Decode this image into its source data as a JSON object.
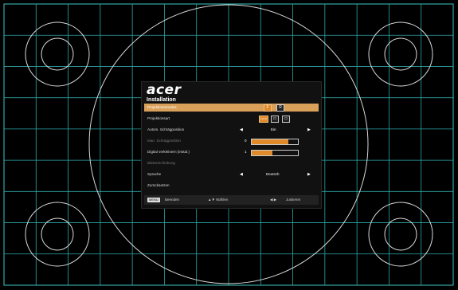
{
  "brand": "acer",
  "menu": {
    "title": "Installation",
    "rows": [
      {
        "label": "Projektionsmodus",
        "selected": true
      },
      {
        "label": "Projektionsart"
      },
      {
        "label": "Autom. Schrägposition",
        "value": "Ein"
      },
      {
        "label": "Man. Schrägposition",
        "value": "0",
        "level": 0.8,
        "dimmed": true
      },
      {
        "label": "Digital verkleinern (instal.)",
        "value": "1",
        "level": 0.45
      },
      {
        "label": "Bildverschiebung",
        "dimmed": true
      },
      {
        "label": "Sprache",
        "value": "Deutsch"
      },
      {
        "label": "Zurücksetzen"
      }
    ],
    "projection_mode_icons": [
      "F",
      "R"
    ],
    "projection_type_icons": [
      "AUTO",
      "desk",
      "ceiling"
    ]
  },
  "footer": {
    "menu_key": "MENU",
    "exit_label": "Beenden",
    "select_label": "▲▼ Wählen",
    "adjust_label": "Justieren"
  }
}
